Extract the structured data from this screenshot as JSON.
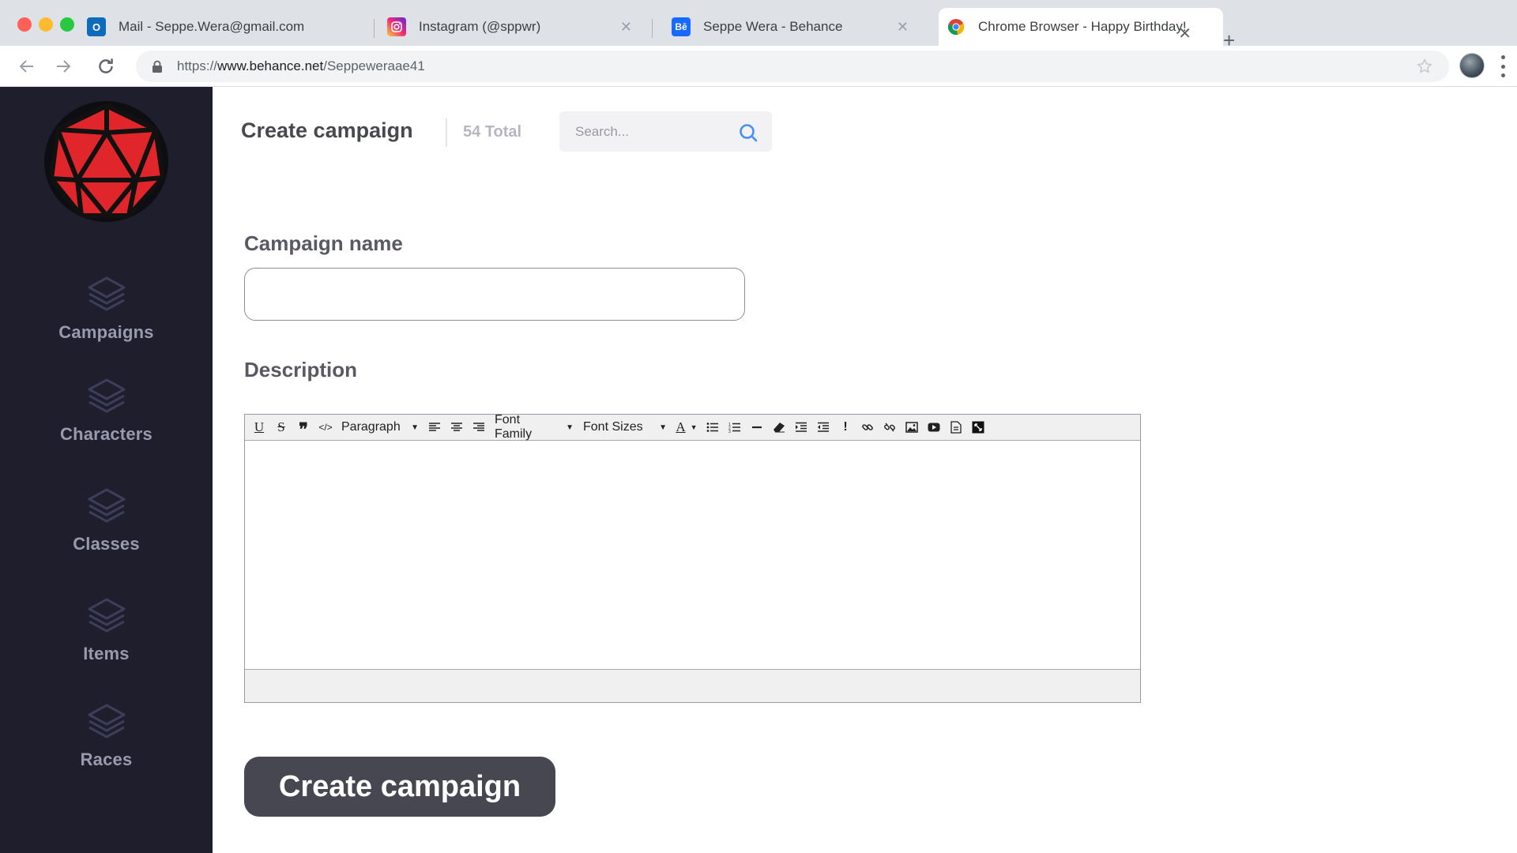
{
  "browser": {
    "tabs": [
      {
        "title": "Mail - Seppe.Wera@gmail.com",
        "icon": "outlook-icon",
        "active": false
      },
      {
        "title": "Instagram (@sppwr)",
        "icon": "instagram-icon",
        "active": false
      },
      {
        "title": "Seppe Wera - Behance",
        "icon": "behance-icon",
        "active": false
      },
      {
        "title": "Chrome Browser - Happy Birthday!",
        "icon": "chrome-icon",
        "active": true
      }
    ],
    "url_scheme": "https://",
    "url_host": "www.behance.net",
    "url_path": "/Seppeweraae41"
  },
  "sidebar": {
    "items": [
      {
        "label": "Campaigns",
        "icon": "layers-icon"
      },
      {
        "label": "Characters",
        "icon": "layers-icon"
      },
      {
        "label": "Classes",
        "icon": "layers-icon"
      },
      {
        "label": "Items",
        "icon": "layers-icon"
      },
      {
        "label": "Races",
        "icon": "layers-icon"
      }
    ]
  },
  "header": {
    "title": "Create campaign",
    "total": "54 Total",
    "search_placeholder": "Search..."
  },
  "form": {
    "name_label": "Campaign name",
    "name_value": "",
    "description_label": "Description",
    "editor": {
      "block_format": "Paragraph",
      "font_family": "Font Family",
      "font_size": "Font Sizes"
    },
    "submit_label": "Create campaign"
  },
  "colors": {
    "sidebar_bg": "#1e1e2d",
    "sidebar_text": "#9a9aae",
    "accent_icon": "#3d3d5c",
    "button_bg": "#474752",
    "search_icon": "#4a8df8",
    "logo_red": "#e0262a"
  }
}
